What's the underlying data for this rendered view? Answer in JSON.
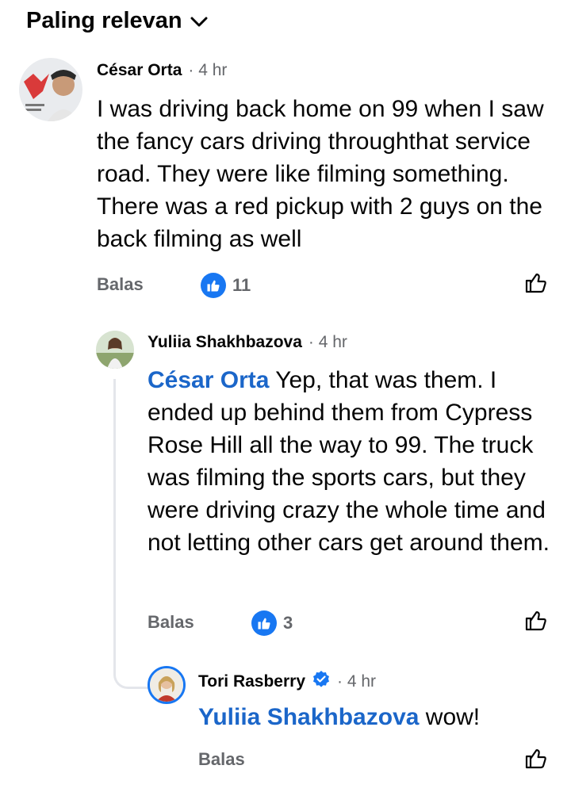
{
  "sort": {
    "label": "Paling relevan"
  },
  "comments": [
    {
      "author": "César Orta",
      "time": "· 4 hr",
      "text": "I was driving back home on 99 when I saw the fancy cars driving throughthat service road. They were like filming something. There was a red pickup with 2 guys on the back filming as well",
      "reply_label": "Balas",
      "reaction_count": "11"
    },
    {
      "author": "Yuliia Shakhbazova",
      "time": "· 4 hr",
      "mention": "César Orta",
      "text": " Yep, that was them. I ended up behind them from Cypress Rose Hill all the way to 99. The truck was filming the sports cars, but they were driving crazy the whole time and not letting other cars get around them.",
      "reply_label": "Balas",
      "reaction_count": "3"
    },
    {
      "author": "Tori Rasberry",
      "time": "· 4 hr",
      "mention": "Yuliia Shakhbazova",
      "text": " wow!",
      "reply_label": "Balas"
    }
  ],
  "colors": {
    "accent": "#1877f2",
    "mention": "#1b66c9",
    "muted": "#65676b"
  }
}
